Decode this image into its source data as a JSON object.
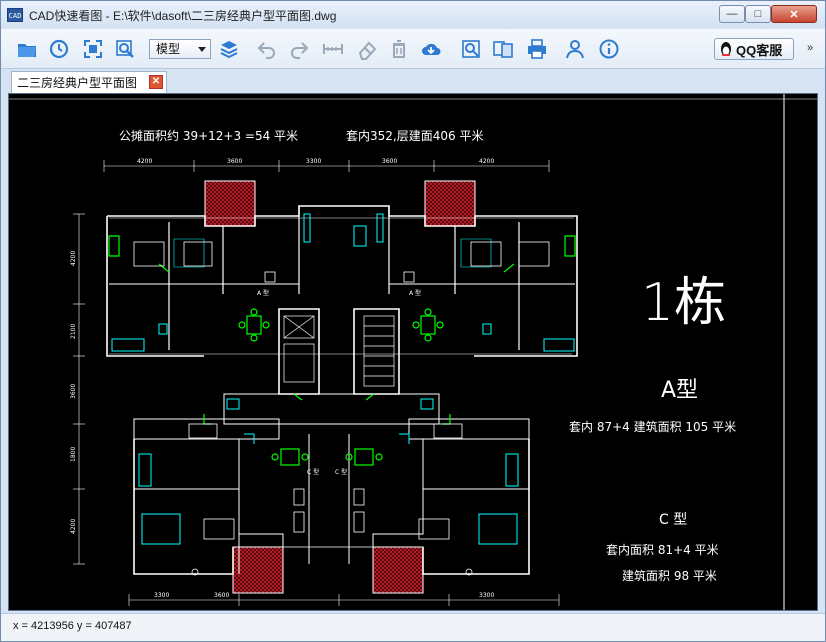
{
  "window": {
    "title": "CAD快速看图 - E:\\软件\\dasoft\\二三房经典户型平面图.dwg",
    "app_icon_label": "CAD",
    "min_glyph": "—",
    "max_glyph": "□",
    "close_glyph": "✕"
  },
  "toolbar": {
    "model_select_value": "模型",
    "qq_label": "QQ客服",
    "more_glyph": "»"
  },
  "tabs": [
    {
      "label": "二三房经典户型平面图",
      "close_glyph": "✕"
    }
  ],
  "drawing": {
    "area_note": "公摊面积约 39+12+3 =54 平米",
    "total_note": "套内352,层建面406 平米",
    "building_label": "1栋",
    "type_a_label": "A型",
    "type_a_area": "套内 87+4  建筑面积 105 平米",
    "type_c_label": "C 型",
    "type_c_inner": "套内面积 81+4 平米",
    "type_c_gross": "建筑面积 98 平米",
    "room_a_left": "A 型",
    "room_a_right": "A 型",
    "room_c_left": "C 型",
    "room_c_right": "C 型",
    "dims_top": [
      "4200",
      "3600",
      "3300",
      "3600",
      "4200"
    ],
    "dims_left": [
      "4200",
      "2100",
      "3600",
      "1800",
      "4200"
    ],
    "dims_bottom": [
      "3300",
      "3600",
      "3300"
    ],
    "colors": {
      "background": "#000000",
      "walls": "#ffffff",
      "fixtures": "#00ffff",
      "furniture": "#00ff00",
      "hatch": "#c8202a"
    }
  },
  "status": {
    "coords": "x = 4213956  y = 407487"
  }
}
